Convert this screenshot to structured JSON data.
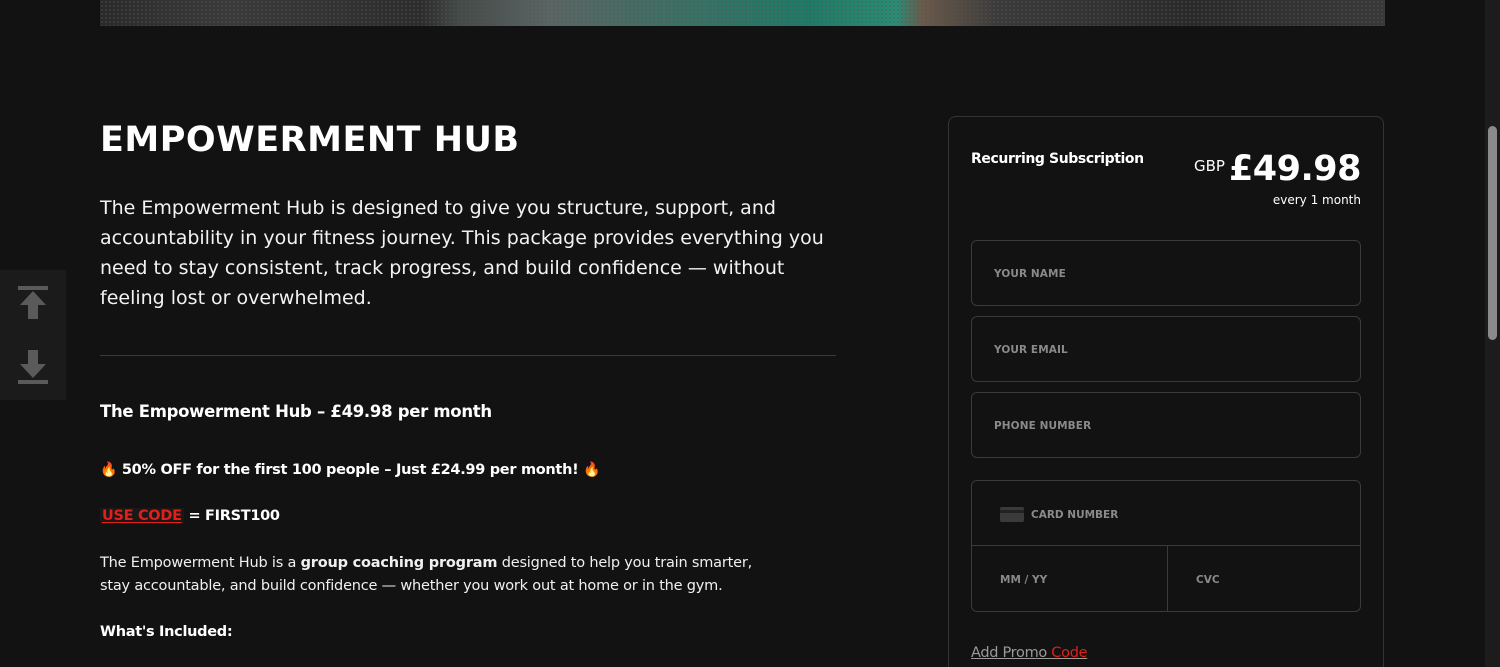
{
  "hero": {
    "image": "fitness-hero-image"
  },
  "scroll_widget": {
    "up_icon": "scroll-to-top-icon",
    "down_icon": "scroll-to-bottom-icon"
  },
  "main": {
    "title": "EMPOWERMENT HUB",
    "intro": "The Empowerment Hub is designed to give you structure, support, and accountability in your fitness journey. This package provides everything you need to stay consistent, track progress, and build confidence — without feeling lost or overwhelmed.",
    "package_title": "The Empowerment Hub – £49.98 per month",
    "offer_text": "50% OFF for the first 100 people – Just £24.99 per month!",
    "offer_icon": "fire-emoji",
    "code_label": "USE CODE",
    "code_value": "= FIRST100",
    "desc_start": "The Empowerment Hub is a ",
    "desc_bold": "group coaching program",
    "desc_end": " designed to help you train smarter, stay accountable, and build confidence — whether you work out at home or in the gym.",
    "included_heading": "What's Included:"
  },
  "checkout": {
    "subscription_label": "Recurring Subscription",
    "currency": "GBP",
    "price": "£49.98",
    "period": "every 1 month",
    "name_placeholder": "YOUR NAME",
    "email_placeholder": "YOUR EMAIL",
    "phone_placeholder": "PHONE NUMBER",
    "card_placeholder": "CARD NUMBER",
    "expiry_placeholder": "MM / YY",
    "cvc_placeholder": "CVC",
    "promo_part1": "Add Promo ",
    "promo_part2": "Code"
  },
  "colors": {
    "background": "#131213",
    "accent_red": "#e0201b",
    "border": "#3a3a3a"
  }
}
